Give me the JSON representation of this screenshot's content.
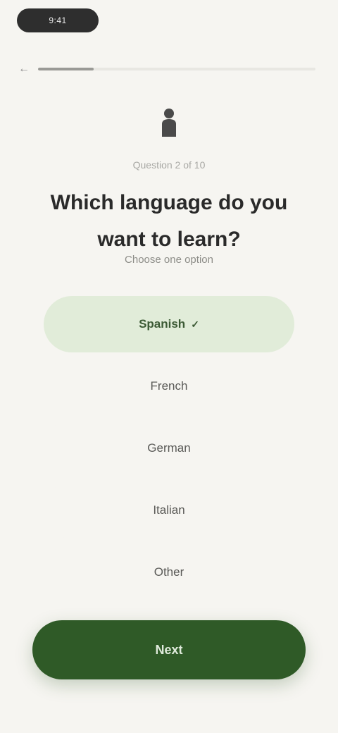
{
  "status": {
    "time": "9:41"
  },
  "progress": {
    "back_icon": "arrow-left-icon",
    "value": 0.2
  },
  "header": {
    "icon": "person-icon",
    "step_label": "Question 2 of 10",
    "question": "Which language do you want to learn?",
    "hint": "Choose one option"
  },
  "options": [
    {
      "label": "Spanish",
      "selected": true
    },
    {
      "label": "French",
      "selected": false
    },
    {
      "label": "German",
      "selected": false
    },
    {
      "label": "Italian",
      "selected": false
    },
    {
      "label": "Other",
      "selected": false
    }
  ],
  "cta": {
    "label": "Next"
  },
  "colors": {
    "background": "#f6f5f1",
    "accent": "#2f5a27",
    "selected_bg": "#e1ecd9"
  }
}
